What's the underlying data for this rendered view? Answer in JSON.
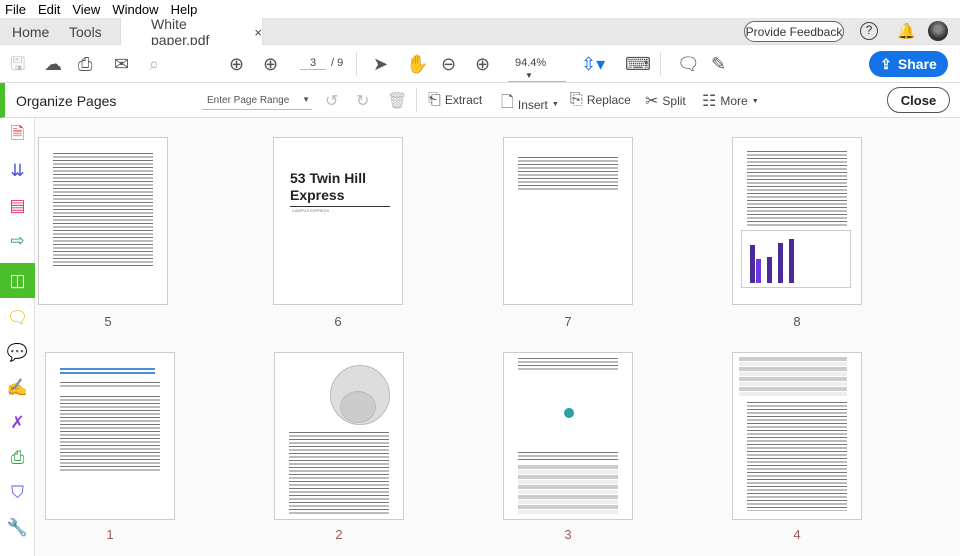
{
  "menu": [
    "File",
    "Edit",
    "View",
    "Window",
    "Help"
  ],
  "tabs": {
    "home": "Home",
    "tools": "Tools",
    "document": "White paper.pdf",
    "close": "×"
  },
  "header": {
    "feedback": "Provide Feedback",
    "help": "?"
  },
  "toolbar": {
    "current_page": "3",
    "total_pages": "/ 9",
    "zoom": "94.4%",
    "share": "Share"
  },
  "organize": {
    "title": "Organize Pages",
    "page_range_placeholder": "Enter Page Range",
    "extract": "Extract",
    "insert": "Insert",
    "replace": "Replace",
    "split": "Split",
    "more": "More",
    "close": "Close"
  },
  "pages": [
    {
      "label": "5"
    },
    {
      "label": "6",
      "title": "53 Twin Hill Express",
      "subtitle": "CAMPUS EXPRESS"
    },
    {
      "label": "7"
    },
    {
      "label": "8"
    },
    {
      "label": "1"
    },
    {
      "label": "2"
    },
    {
      "label": "3"
    },
    {
      "label": "4"
    }
  ],
  "colors": {
    "accent": "#1473e6",
    "organize_green": "#4bbf2a"
  }
}
